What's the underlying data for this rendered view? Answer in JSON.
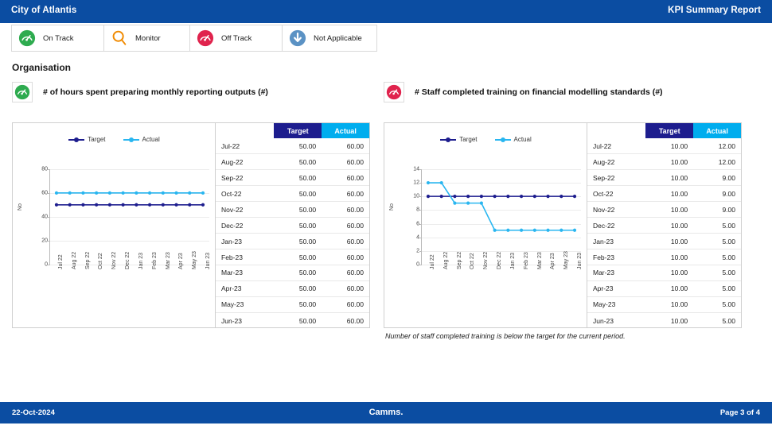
{
  "header": {
    "org_title": "City of Atlantis",
    "report_title": "KPI Summary Report"
  },
  "status_legend": [
    {
      "key": "on-track",
      "label": "On Track",
      "icon": "gauge-green-icon",
      "color": "#2eab4f"
    },
    {
      "key": "monitor",
      "label": "Monitor",
      "icon": "magnifier-icon",
      "color": "#f08a00"
    },
    {
      "key": "off-track",
      "label": "Off Track",
      "icon": "gauge-red-icon",
      "color": "#e0234d"
    },
    {
      "key": "not-applicable",
      "label": "Not Applicable",
      "icon": "down-arrow-icon",
      "color": "#5b92c4"
    }
  ],
  "section": {
    "title": "Organisation"
  },
  "colors": {
    "header_blue": "#0b4da2",
    "target": "#1d1d8e",
    "actual": "#29b6f0",
    "table_target_header": "#1d1d8e",
    "table_actual_header": "#00adee"
  },
  "table_headers": {
    "period": "",
    "target": "Target",
    "actual": "Actual"
  },
  "kpis": [
    {
      "id": "hours-reporting",
      "title": "# of hours spent preparing monthly reporting outputs (#)",
      "status": "on-track",
      "status_icon": "gauge-green-icon",
      "rows": [
        {
          "period": "Jul-22",
          "target": "50.00",
          "actual": "60.00"
        },
        {
          "period": "Aug-22",
          "target": "50.00",
          "actual": "60.00"
        },
        {
          "period": "Sep-22",
          "target": "50.00",
          "actual": "60.00"
        },
        {
          "period": "Oct-22",
          "target": "50.00",
          "actual": "60.00"
        },
        {
          "period": "Nov-22",
          "target": "50.00",
          "actual": "60.00"
        },
        {
          "period": "Dec-22",
          "target": "50.00",
          "actual": "60.00"
        },
        {
          "period": "Jan-23",
          "target": "50.00",
          "actual": "60.00"
        },
        {
          "period": "Feb-23",
          "target": "50.00",
          "actual": "60.00"
        },
        {
          "period": "Mar-23",
          "target": "50.00",
          "actual": "60.00"
        },
        {
          "period": "Apr-23",
          "target": "50.00",
          "actual": "60.00"
        },
        {
          "period": "May-23",
          "target": "50.00",
          "actual": "60.00"
        },
        {
          "period": "Jun-23",
          "target": "50.00",
          "actual": "60.00"
        }
      ],
      "comment": ""
    },
    {
      "id": "staff-training",
      "title": "# Staff completed training on financial modelling standards (#)",
      "status": "off-track",
      "status_icon": "gauge-red-icon",
      "rows": [
        {
          "period": "Jul-22",
          "target": "10.00",
          "actual": "12.00"
        },
        {
          "period": "Aug-22",
          "target": "10.00",
          "actual": "12.00"
        },
        {
          "period": "Sep-22",
          "target": "10.00",
          "actual": "9.00"
        },
        {
          "period": "Oct-22",
          "target": "10.00",
          "actual": "9.00"
        },
        {
          "period": "Nov-22",
          "target": "10.00",
          "actual": "9.00"
        },
        {
          "period": "Dec-22",
          "target": "10.00",
          "actual": "5.00"
        },
        {
          "period": "Jan-23",
          "target": "10.00",
          "actual": "5.00"
        },
        {
          "period": "Feb-23",
          "target": "10.00",
          "actual": "5.00"
        },
        {
          "period": "Mar-23",
          "target": "10.00",
          "actual": "5.00"
        },
        {
          "period": "Apr-23",
          "target": "10.00",
          "actual": "5.00"
        },
        {
          "period": "May-23",
          "target": "10.00",
          "actual": "5.00"
        },
        {
          "period": "Jun-23",
          "target": "10.00",
          "actual": "5.00"
        }
      ],
      "comment": "Number of staff completed training is below the target for the current period."
    }
  ],
  "chart_data": [
    {
      "type": "line",
      "title": "# of hours spent preparing monthly reporting outputs (#)",
      "xlabel": "",
      "ylabel": "No",
      "ylim": [
        0,
        80
      ],
      "yticks": [
        0,
        20,
        40,
        60,
        80
      ],
      "grid": true,
      "legend_position": "top-center",
      "categories": [
        "Jul 22",
        "Aug 22",
        "Sep 22",
        "Oct 22",
        "Nov 22",
        "Dec 22",
        "Jan 23",
        "Feb 23",
        "Mar 23",
        "Apr 23",
        "May 23",
        "Jun 23"
      ],
      "series": [
        {
          "name": "Target",
          "color": "#1d1d8e",
          "values": [
            50,
            50,
            50,
            50,
            50,
            50,
            50,
            50,
            50,
            50,
            50,
            50
          ]
        },
        {
          "name": "Actual",
          "color": "#29b6f0",
          "values": [
            60,
            60,
            60,
            60,
            60,
            60,
            60,
            60,
            60,
            60,
            60,
            60
          ]
        }
      ]
    },
    {
      "type": "line",
      "title": "# Staff completed training on financial modelling standards (#)",
      "xlabel": "",
      "ylabel": "No",
      "ylim": [
        0,
        14
      ],
      "yticks": [
        0,
        2,
        4,
        6,
        8,
        10,
        12,
        14
      ],
      "grid": true,
      "legend_position": "top-center",
      "categories": [
        "Jul 22",
        "Aug 22",
        "Sep 22",
        "Oct 22",
        "Nov 22",
        "Dec 22",
        "Jan 23",
        "Feb 23",
        "Mar 23",
        "Apr 23",
        "May 23",
        "Jun 23"
      ],
      "series": [
        {
          "name": "Target",
          "color": "#1d1d8e",
          "values": [
            10,
            10,
            10,
            10,
            10,
            10,
            10,
            10,
            10,
            10,
            10,
            10
          ]
        },
        {
          "name": "Actual",
          "color": "#29b6f0",
          "values": [
            12,
            12,
            9,
            9,
            9,
            5,
            5,
            5,
            5,
            5,
            5,
            5
          ]
        }
      ]
    }
  ],
  "legend_series": [
    {
      "name": "Target",
      "color": "#1d1d8e"
    },
    {
      "name": "Actual",
      "color": "#29b6f0"
    }
  ],
  "footer": {
    "date": "22-Oct-2024",
    "brand": "Camms.",
    "page": "Page 3 of 4"
  }
}
